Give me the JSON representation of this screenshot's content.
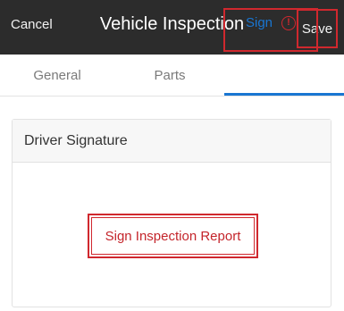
{
  "header": {
    "cancel_label": "Cancel",
    "title": "Vehicle Inspection",
    "save_label": "Save"
  },
  "tabs": [
    {
      "label": "General",
      "active": false
    },
    {
      "label": "Parts",
      "active": false
    },
    {
      "label": "Sign",
      "active": true,
      "icon": "warning-icon",
      "icon_glyph": "!"
    }
  ],
  "card": {
    "header": "Driver Signature",
    "button_label": "Sign Inspection Report"
  },
  "colors": {
    "topbar": "#2c2c2c",
    "accent": "#1976d2",
    "alert": "#d0282e"
  }
}
